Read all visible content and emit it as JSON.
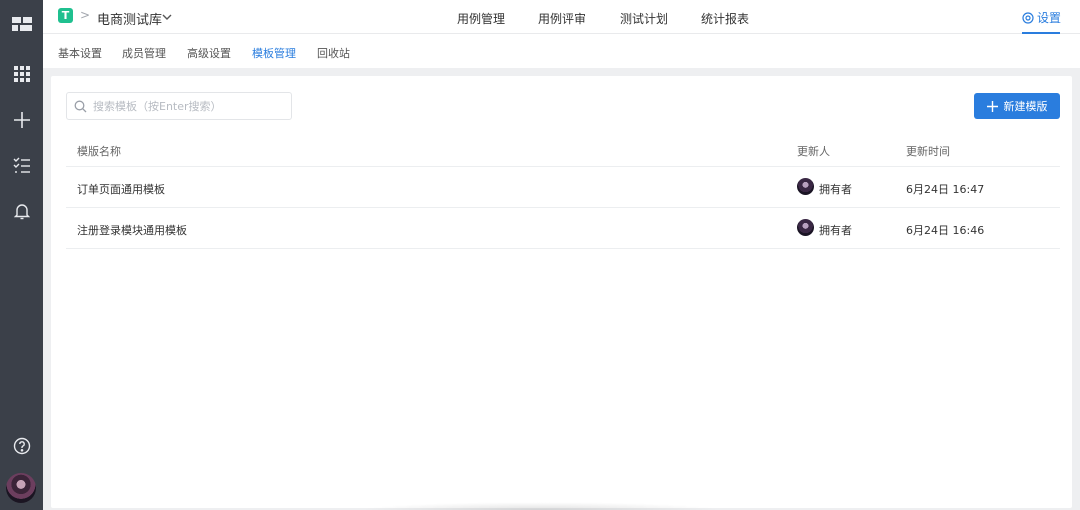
{
  "rail": {
    "icons": [
      "layout-icon",
      "apps-grid-icon",
      "plus-icon",
      "checklist-icon",
      "bell-icon",
      "help-icon"
    ]
  },
  "topbar": {
    "logo_letter": "T",
    "breadcrumb_separator": ">",
    "project_name": "电商测试库",
    "nav": [
      "用例管理",
      "用例评审",
      "测试计划",
      "统计报表"
    ],
    "settings_label": "设置"
  },
  "subtabs": {
    "items": [
      "基本设置",
      "成员管理",
      "高级设置",
      "模板管理",
      "回收站"
    ],
    "active": "模板管理"
  },
  "toolbar": {
    "search_placeholder": "搜索模板（按Enter搜索）",
    "search_value": "",
    "new_button_label": "新建模版"
  },
  "table": {
    "headers": [
      "模版名称",
      "更新人",
      "更新时间"
    ],
    "rows": [
      {
        "name": "订单页面通用模板",
        "updater": "拥有者",
        "updated_at": "6月24日 16:47"
      },
      {
        "name": "注册登录模块通用模板",
        "updater": "拥有者",
        "updated_at": "6月24日 16:46"
      }
    ]
  },
  "colors": {
    "rail_bg": "#3b4049",
    "accent": "#2a7dde",
    "logo_green": "#1fc08f",
    "content_bg": "#eeeff1"
  }
}
